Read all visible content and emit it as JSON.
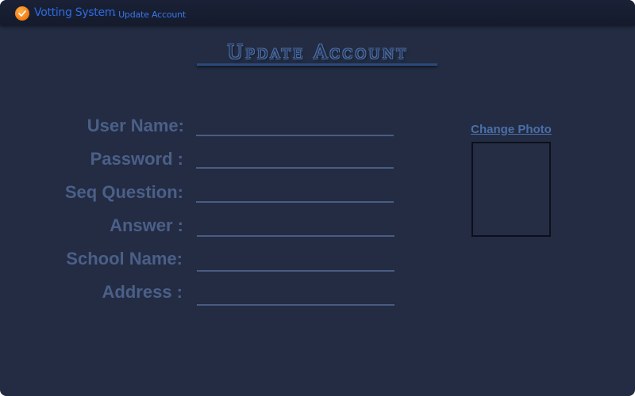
{
  "window": {
    "app_name": "Votting System",
    "subtitle": "- Update Account",
    "icon": "ballot-icon"
  },
  "page": {
    "title": "Update Account"
  },
  "form": {
    "fields": [
      {
        "label": "User Name:",
        "value": ""
      },
      {
        "label": "Password :",
        "value": ""
      },
      {
        "label": "Seq Question:",
        "value": ""
      },
      {
        "label": "Answer :",
        "value": ""
      },
      {
        "label": "School Name:",
        "value": ""
      },
      {
        "label": "Address :",
        "value": ""
      }
    ]
  },
  "photo": {
    "change_label": "Change Photo"
  },
  "colors": {
    "background": "#232c43",
    "titlebar": "#151b2d",
    "label": "#4b5f88",
    "accent": "#2f6be0"
  }
}
